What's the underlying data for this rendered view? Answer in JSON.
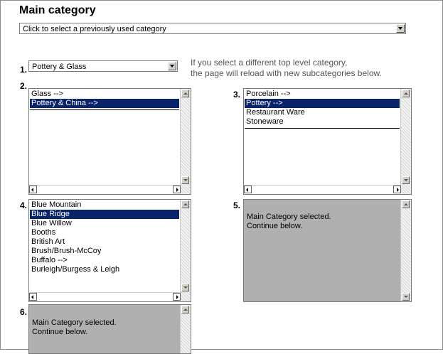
{
  "title": "Main category",
  "previous_category_select": {
    "value": "Click to select a previously used category"
  },
  "step1": {
    "number": "1.",
    "value": "Pottery & Glass"
  },
  "hint": {
    "line1": "If you select a different top level category,",
    "line2": "the page will reload with new subcategories below."
  },
  "list2": {
    "number": "2.",
    "items": [
      "Glass -->",
      "Pottery & China -->"
    ],
    "selected": 1
  },
  "list3": {
    "number": "3.",
    "items": [
      "Porcelain -->",
      "Pottery -->",
      "Restaurant Ware",
      "Stoneware"
    ],
    "selected": 1
  },
  "list4": {
    "number": "4.",
    "items": [
      "Blue Mountain",
      "Blue Ridge",
      "Blue Willow",
      "Booths",
      "British Art",
      "Brush/Brush-McCoy",
      "Buffalo -->",
      "Burleigh/Burgess & Leigh"
    ],
    "selected": 1
  },
  "list5": {
    "number": "5.",
    "message_line1": "Main Category selected.",
    "message_line2": "Continue below."
  },
  "list6": {
    "number": "6.",
    "message_line1": "Main Category selected.",
    "message_line2": "Continue below."
  },
  "colors": {
    "selection": "#0a246a",
    "disabled_list": "#b0b0b0"
  }
}
